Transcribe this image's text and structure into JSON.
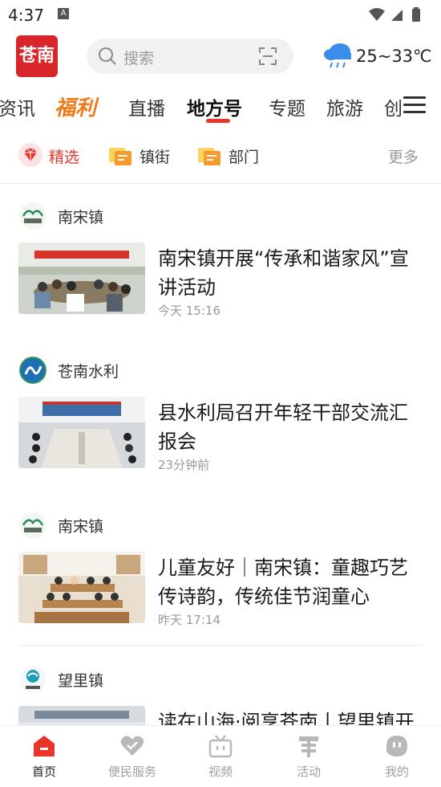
{
  "status": {
    "time": "4:37",
    "notif_glyph": "A"
  },
  "header": {
    "logo_text": "苍南",
    "search_placeholder": "搜索",
    "weather": {
      "icon": "rain-cloud-icon",
      "temp": "25~33℃"
    }
  },
  "tabs": [
    {
      "label": "资讯"
    },
    {
      "label": "福利"
    },
    {
      "label": "直播"
    },
    {
      "label": "地方号",
      "active": true
    },
    {
      "label": "专题"
    },
    {
      "label": "旅游"
    },
    {
      "label": "创"
    }
  ],
  "subtabs": {
    "items": [
      {
        "label": "精选",
        "icon": "diamond-icon",
        "color": "#e8352a"
      },
      {
        "label": "镇街",
        "icon": "tag-icon",
        "color": "#333333"
      },
      {
        "label": "部门",
        "icon": "tag-icon",
        "color": "#333333"
      }
    ],
    "more": "更多"
  },
  "feed": [
    {
      "source": "南宋镇",
      "title": "南宋镇开展“传承和谐家风”宣讲活动",
      "time": "今天 15:16"
    },
    {
      "source": "苍南水利",
      "title": "县水利局召开年轻干部交流汇报会",
      "time": "23分钟前"
    },
    {
      "source": "南宋镇",
      "title": "儿童友好｜南宋镇：童趣巧艺传诗韵，传统佳节润童心",
      "time": "昨天 17:14"
    },
    {
      "source": "望里镇",
      "title": "读在山海·阅享苍南丨望里镇开",
      "time": ""
    }
  ],
  "bottom_nav": [
    {
      "label": "首页",
      "icon": "home-icon",
      "active": true
    },
    {
      "label": "便民服务",
      "icon": "heart-icon"
    },
    {
      "label": "视频",
      "icon": "tv-icon"
    },
    {
      "label": "活动",
      "icon": "activity-icon"
    },
    {
      "label": "我的",
      "icon": "profile-icon"
    }
  ],
  "colors": {
    "accent": "#e8352a",
    "fuli": "#f07a1a"
  }
}
